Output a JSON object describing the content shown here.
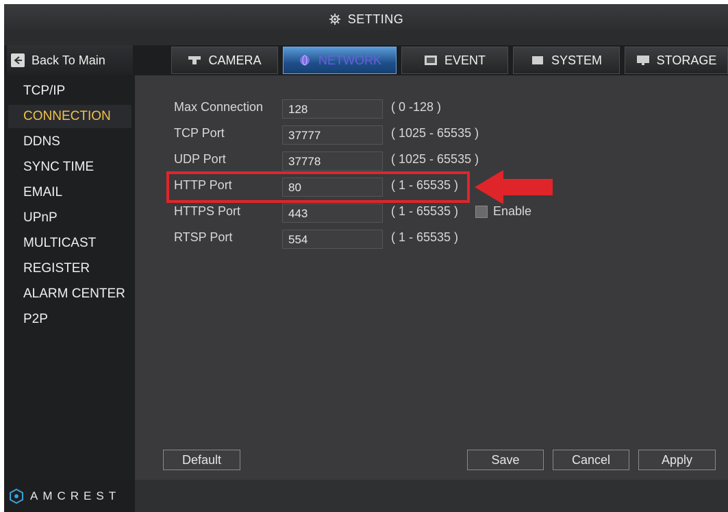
{
  "window": {
    "title": "SETTING"
  },
  "nav": {
    "back_label": "Back To Main",
    "tabs": [
      {
        "label": "CAMERA",
        "icon": "camera-icon"
      },
      {
        "label": "NETWORK",
        "icon": "globe-icon",
        "active": true
      },
      {
        "label": "EVENT",
        "icon": "event-icon"
      },
      {
        "label": "SYSTEM",
        "icon": "system-icon"
      },
      {
        "label": "STORAGE",
        "icon": "monitor-icon"
      }
    ]
  },
  "sidebar": {
    "items": [
      {
        "label": "TCP/IP"
      },
      {
        "label": "CONNECTION",
        "selected": true
      },
      {
        "label": "DDNS"
      },
      {
        "label": "SYNC TIME"
      },
      {
        "label": "EMAIL"
      },
      {
        "label": "UPnP"
      },
      {
        "label": "MULTICAST"
      },
      {
        "label": "REGISTER"
      },
      {
        "label": "ALARM CENTER"
      },
      {
        "label": "P2P"
      }
    ]
  },
  "form": {
    "rows": [
      {
        "label": "Max Connection",
        "value": "128",
        "range": "( 0 -128 )"
      },
      {
        "label": "TCP Port",
        "value": "37777",
        "range": "( 1025 - 65535 )"
      },
      {
        "label": "UDP Port",
        "value": "37778",
        "range": "( 1025 - 65535 )"
      },
      {
        "label": "HTTP Port",
        "value": "80",
        "range": "( 1 - 65535 )",
        "highlighted": true
      },
      {
        "label": "HTTPS Port",
        "value": "443",
        "range": "( 1 - 65535 )",
        "enable_label": "Enable",
        "enabled": false
      },
      {
        "label": "RTSP Port",
        "value": "554",
        "range": "( 1 - 65535 )"
      }
    ]
  },
  "buttons": {
    "default": "Default",
    "save": "Save",
    "cancel": "Cancel",
    "apply": "Apply"
  },
  "brand": {
    "name": "AMCREST"
  },
  "colors": {
    "selected_text": "#f2c14a",
    "highlight_red": "#e0252a",
    "active_tab": "#1e4f8a"
  }
}
